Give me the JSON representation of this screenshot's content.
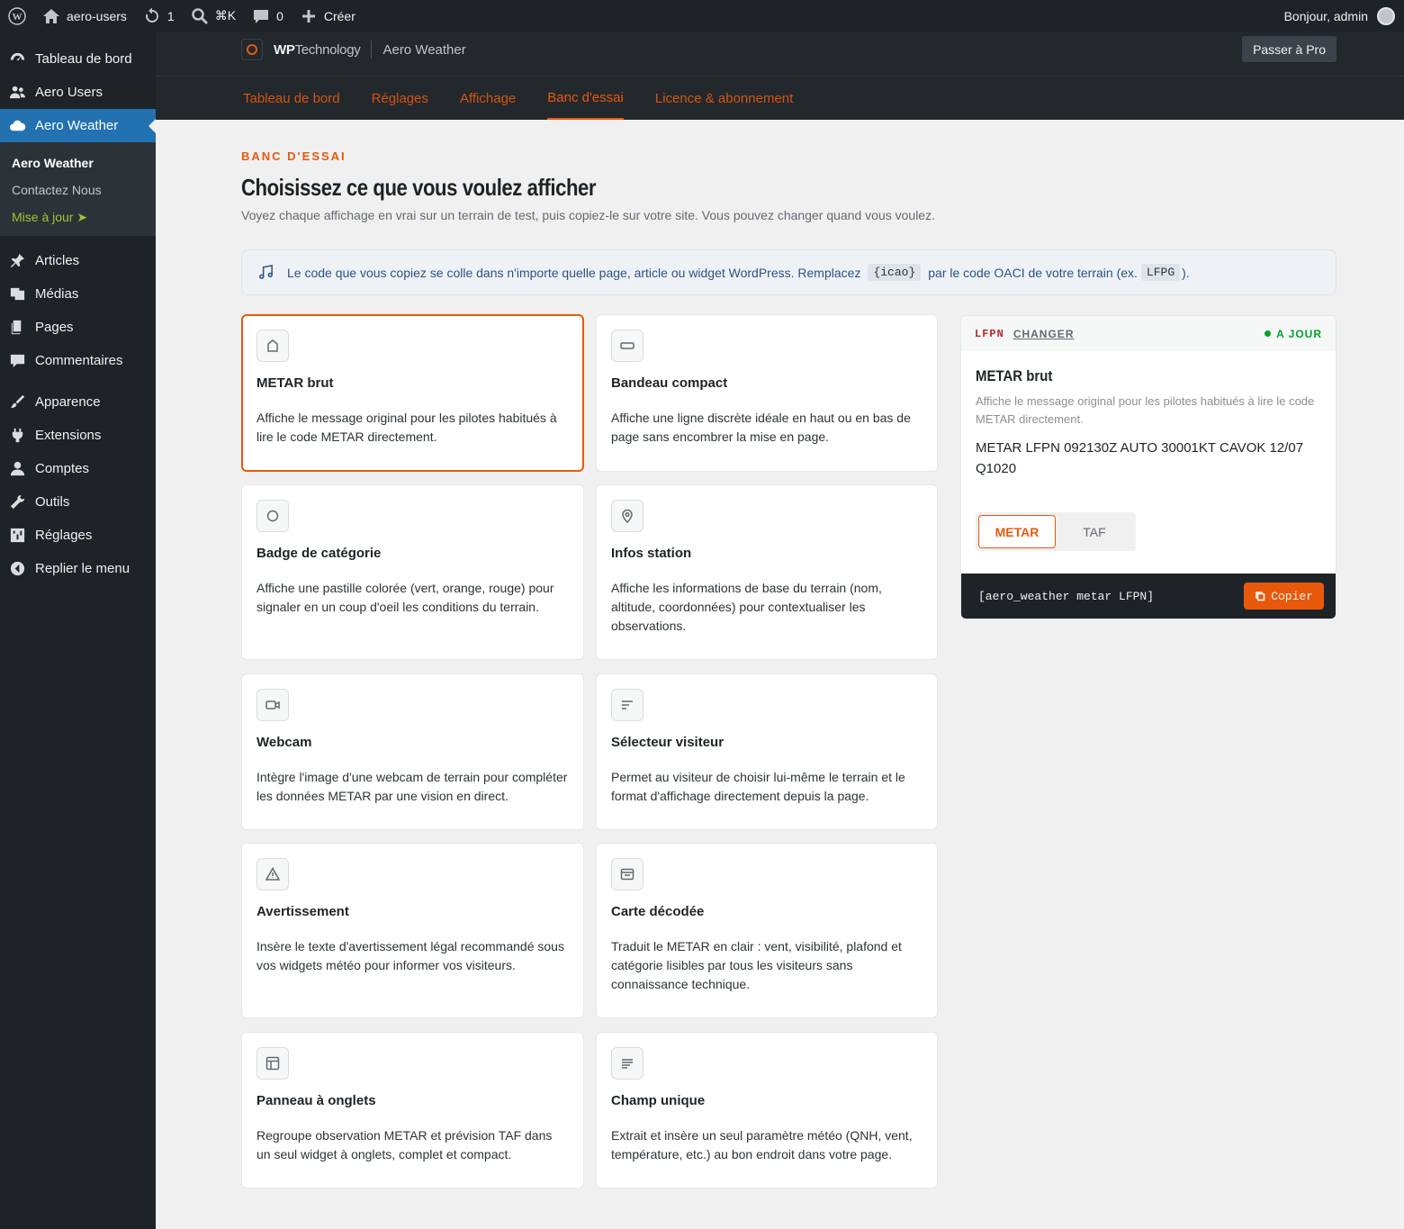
{
  "adminbar": {
    "site": "aero-users",
    "updates": "1",
    "shortcut": "⌘K",
    "comments": "0",
    "create": "Créer",
    "greeting": "Bonjour, admin"
  },
  "sidebar": {
    "items_top": [
      "Tableau de bord",
      "Aero Users",
      "Aero Weather"
    ],
    "submenu": [
      "Aero Weather",
      "Contactez Nous",
      "Mise à jour"
    ],
    "items_mid": [
      "Articles",
      "Médias",
      "Pages",
      "Commentaires"
    ],
    "items_bottom": [
      "Apparence",
      "Extensions",
      "Comptes",
      "Outils",
      "Réglages",
      "Replier le menu"
    ]
  },
  "header": {
    "brand_bold": "WP",
    "brand_rest": "Technology",
    "page": "Aero Weather",
    "pro_button": "Passer à Pro",
    "tabs": [
      "Tableau de bord",
      "Réglages",
      "Affichage",
      "Banc d'essai",
      "Licence & abonnement"
    ]
  },
  "main": {
    "eyebrow": "BANC D'ESSAI",
    "title": "Choisissez ce que vous voulez afficher",
    "subtitle": "Voyez chaque affichage en vrai sur un terrain de test, puis copiez-le sur votre site. Vous pouvez changer quand vous voulez.",
    "notice": {
      "part1": "Le code que vous copiez se colle dans n'importe quelle page, article ou widget WordPress. Remplacez",
      "code1": "{icao}",
      "part2": "par le code OACI de votre terrain (ex.",
      "code2": "LFPG",
      "part3": ")."
    },
    "cards": [
      {
        "title": "METAR brut",
        "desc": "Affiche le message original pour les pilotes habitués à lire le code METAR directement."
      },
      {
        "title": "Bandeau compact",
        "desc": "Affiche une ligne discrète idéale en haut ou en bas de page sans encombrer la mise en page."
      },
      {
        "title": "Badge de catégorie",
        "desc": "Affiche une pastille colorée (vert, orange, rouge) pour signaler en un coup d'oeil les conditions du terrain."
      },
      {
        "title": "Infos station",
        "desc": "Affiche les informations de base du terrain (nom, altitude, coordonnées) pour contextualiser les observations."
      },
      {
        "title": "Webcam",
        "desc": "Intègre l'image d'une webcam de terrain pour compléter les données METAR par une vision en direct."
      },
      {
        "title": "Sélecteur visiteur",
        "desc": "Permet au visiteur de choisir lui-même le terrain et le format d'affichage directement depuis la page."
      },
      {
        "title": "Avertissement",
        "desc": "Insère le texte d'avertissement légal recommandé sous vos widgets météo pour informer vos visiteurs."
      },
      {
        "title": "Carte décodée",
        "desc": "Traduit le METAR en clair : vent, visibilité, plafond et catégorie lisibles par tous les visiteurs sans connaissance technique."
      },
      {
        "title": "Panneau à onglets",
        "desc": "Regroupe observation METAR et prévision TAF dans un seul widget à onglets, complet et compact."
      },
      {
        "title": "Champ unique",
        "desc": "Extrait et insère un seul paramètre météo (QNH, vent, température, etc.) au bon endroit dans votre page."
      }
    ],
    "preview": {
      "icao": "LFPN",
      "change": "CHANGER",
      "status": "A JOUR",
      "title": "METAR brut",
      "desc": "Affiche le message original pour les pilotes habitués à lire le code METAR directement.",
      "metar": "METAR LFPN 092130Z AUTO 30001KT CAVOK 12/07 Q1020",
      "tab_metar": "METAR",
      "tab_taf": "TAF",
      "shortcode": "[aero_weather metar LFPN]",
      "copy": "Copier"
    }
  },
  "colors": {
    "accent": "#e8590c",
    "wp_blue": "#2271b1",
    "dark": "#1d2327"
  }
}
